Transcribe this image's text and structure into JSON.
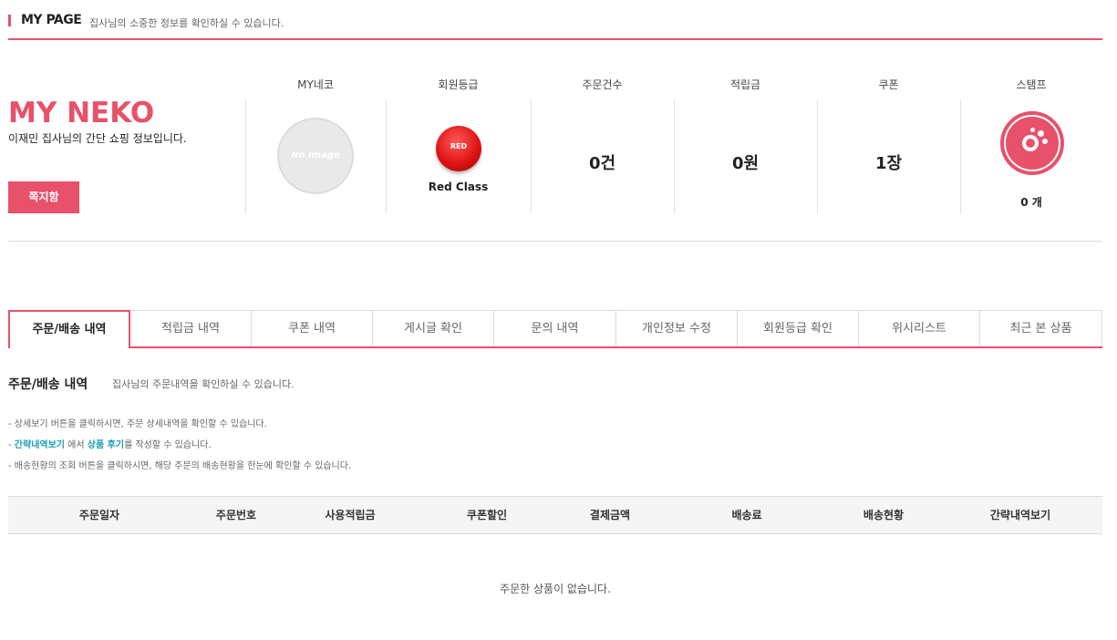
{
  "header": {
    "title": "MY PAGE",
    "description": "집사님의 소중한 정보를 확인하실 수 있습니다."
  },
  "profile": {
    "brand": "MY NEKO",
    "description": "이재민 집사님의 간단 쇼핑 정보입니다.",
    "message_button": "쪽지함"
  },
  "stats": {
    "myneko": {
      "label": "MY네코",
      "image_text": "No Image"
    },
    "grade": {
      "label": "회원등급",
      "badge": "RED",
      "name": "Red Class",
      "color": "#e01515"
    },
    "orders": {
      "label": "주문건수",
      "value": "0건"
    },
    "points": {
      "label": "적립금",
      "value": "0원"
    },
    "coupons": {
      "label": "쿠폰",
      "value": "1장"
    },
    "stamps": {
      "label": "스탬프",
      "value": "0 개",
      "icon": "stamp-icon"
    }
  },
  "tabs": [
    {
      "label": "주문/배송 내역",
      "active": true
    },
    {
      "label": "적립금 내역",
      "active": false
    },
    {
      "label": "쿠폰 내역",
      "active": false
    },
    {
      "label": "게시글 확인",
      "active": false
    },
    {
      "label": "문의 내역",
      "active": false
    },
    {
      "label": "개인정보 수정",
      "active": false
    },
    {
      "label": "회원등급 확인",
      "active": false
    },
    {
      "label": "위시리스트",
      "active": false
    },
    {
      "label": "최근 본 상품",
      "active": false
    }
  ],
  "section": {
    "title": "주문/배송 내역",
    "description": "집사님의 주문내역을 확인하실 수 있습니다.",
    "notes": {
      "line1": "- 상세보기 버튼을 클릭하시면, 주문 상세내역을 확인할 수 있습니다.",
      "line2_prefix": "- ",
      "line2_link1": "간략내역보기",
      "line2_mid": " 에서 ",
      "line2_link2": "상품 후기",
      "line2_suffix": "를 작성할 수 있습니다.",
      "line3": "- 배송현황의 조회 버튼을 클릭하시면, 해당 주문의 배송현황을 한눈에 확인할 수 있습니다."
    }
  },
  "table": {
    "columns": [
      "주문일자",
      "주문번호",
      "사용적립금",
      "쿠폰할인",
      "결제금액",
      "배송료",
      "배송현황",
      "간략내역보기"
    ],
    "empty_message": "주문한 상품이 없습니다."
  },
  "colors": {
    "accent": "#e8516a",
    "link": "#1a9eb3"
  }
}
